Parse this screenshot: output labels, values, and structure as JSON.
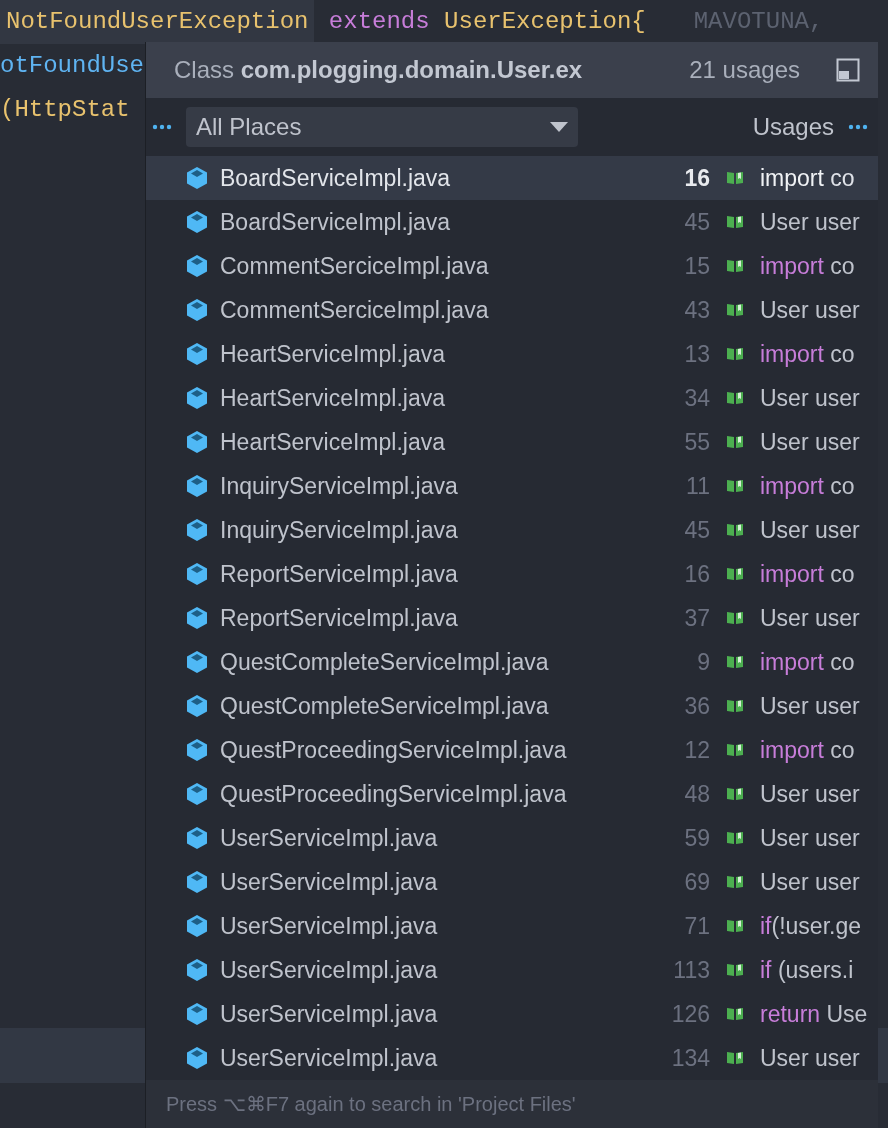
{
  "editor": {
    "lines": [
      {
        "segments": [
          {
            "text": "NotFoundUserException",
            "kind": "type",
            "highlighted": true
          },
          {
            "text": " extends ",
            "kind": "keyword",
            "highlighted": false
          },
          {
            "text": "UserException{",
            "kind": "type",
            "highlighted": false
          },
          {
            "text": "MAVOTUNA,",
            "kind": "hint",
            "highlighted": false
          }
        ]
      },
      {
        "segments": [
          {
            "text": "otFoundUse",
            "kind": "ident",
            "highlighted": false
          }
        ]
      },
      {
        "segments": [
          {
            "text": "(HttpStat",
            "kind": "type",
            "highlighted": false
          }
        ]
      }
    ]
  },
  "popup": {
    "title_prefix": "Class",
    "title_name": "com.plogging.domain.User.ex",
    "count": "21 usages",
    "scope": "All Places",
    "column_label": "Usages",
    "rows": [
      {
        "file": "BoardServiceImpl.java",
        "line": "16",
        "selected": true,
        "snippet": [
          {
            "text": "import",
            "kind": "keyword"
          },
          {
            "text": " co",
            "kind": "plain"
          }
        ]
      },
      {
        "file": "BoardServiceImpl.java",
        "line": "45",
        "selected": false,
        "snippet": [
          {
            "text": "User user",
            "kind": "plain"
          }
        ]
      },
      {
        "file": "CommentSerciceImpl.java",
        "line": "15",
        "selected": false,
        "snippet": [
          {
            "text": "import",
            "kind": "keyword"
          },
          {
            "text": " co",
            "kind": "plain"
          }
        ]
      },
      {
        "file": "CommentSerciceImpl.java",
        "line": "43",
        "selected": false,
        "snippet": [
          {
            "text": "User user",
            "kind": "plain"
          }
        ]
      },
      {
        "file": "HeartServiceImpl.java",
        "line": "13",
        "selected": false,
        "snippet": [
          {
            "text": "import",
            "kind": "keyword"
          },
          {
            "text": " co",
            "kind": "plain"
          }
        ]
      },
      {
        "file": "HeartServiceImpl.java",
        "line": "34",
        "selected": false,
        "snippet": [
          {
            "text": "User user",
            "kind": "plain"
          }
        ]
      },
      {
        "file": "HeartServiceImpl.java",
        "line": "55",
        "selected": false,
        "snippet": [
          {
            "text": "User user",
            "kind": "plain"
          }
        ]
      },
      {
        "file": "InquiryServiceImpl.java",
        "line": "11",
        "selected": false,
        "snippet": [
          {
            "text": "import",
            "kind": "keyword"
          },
          {
            "text": " co",
            "kind": "plain"
          }
        ]
      },
      {
        "file": "InquiryServiceImpl.java",
        "line": "45",
        "selected": false,
        "snippet": [
          {
            "text": "User user",
            "kind": "plain"
          }
        ]
      },
      {
        "file": "ReportServiceImpl.java",
        "line": "16",
        "selected": false,
        "snippet": [
          {
            "text": "import",
            "kind": "keyword"
          },
          {
            "text": " co",
            "kind": "plain"
          }
        ]
      },
      {
        "file": "ReportServiceImpl.java",
        "line": "37",
        "selected": false,
        "snippet": [
          {
            "text": "User user",
            "kind": "plain"
          }
        ]
      },
      {
        "file": "QuestCompleteServiceImpl.java",
        "line": "9",
        "selected": false,
        "snippet": [
          {
            "text": "import",
            "kind": "keyword"
          },
          {
            "text": " co",
            "kind": "plain"
          }
        ]
      },
      {
        "file": "QuestCompleteServiceImpl.java",
        "line": "36",
        "selected": false,
        "snippet": [
          {
            "text": "User user",
            "kind": "plain"
          }
        ]
      },
      {
        "file": "QuestProceedingServiceImpl.java",
        "line": "12",
        "selected": false,
        "snippet": [
          {
            "text": "import",
            "kind": "keyword"
          },
          {
            "text": " co",
            "kind": "plain"
          }
        ]
      },
      {
        "file": "QuestProceedingServiceImpl.java",
        "line": "48",
        "selected": false,
        "snippet": [
          {
            "text": "User user",
            "kind": "plain"
          }
        ]
      },
      {
        "file": "UserServiceImpl.java",
        "line": "59",
        "selected": false,
        "snippet": [
          {
            "text": "User user",
            "kind": "plain"
          }
        ]
      },
      {
        "file": "UserServiceImpl.java",
        "line": "69",
        "selected": false,
        "snippet": [
          {
            "text": "User user",
            "kind": "plain"
          }
        ]
      },
      {
        "file": "UserServiceImpl.java",
        "line": "71",
        "selected": false,
        "snippet": [
          {
            "text": "if",
            "kind": "keyword"
          },
          {
            "text": "(!user.ge",
            "kind": "plain"
          }
        ]
      },
      {
        "file": "UserServiceImpl.java",
        "line": "113",
        "selected": false,
        "snippet": [
          {
            "text": "if",
            "kind": "keyword"
          },
          {
            "text": " (users.i",
            "kind": "plain"
          }
        ]
      },
      {
        "file": "UserServiceImpl.java",
        "line": "126",
        "selected": false,
        "snippet": [
          {
            "text": "return",
            "kind": "keyword"
          },
          {
            "text": " Use",
            "kind": "plain"
          }
        ]
      },
      {
        "file": "UserServiceImpl.java",
        "line": "134",
        "selected": false,
        "snippet": [
          {
            "text": "User user",
            "kind": "plain"
          }
        ]
      }
    ],
    "footer": "Press ⌥⌘F7 again to search in 'Project Files'"
  }
}
